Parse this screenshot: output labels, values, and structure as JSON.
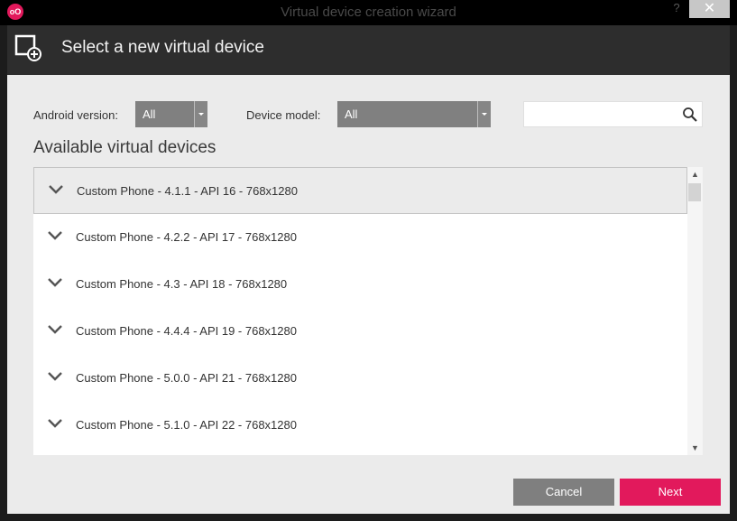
{
  "window": {
    "app_icon_text": "oO",
    "title": "Virtual device creation wizard",
    "help_label": "?",
    "close_label": "✕"
  },
  "header": {
    "title": "Select a new virtual device",
    "icon": "add-device-icon"
  },
  "filters": {
    "android_version_label": "Android version:",
    "android_version_value": "All",
    "device_model_label": "Device model:",
    "device_model_value": "All",
    "search_value": "",
    "search_icon": "search-icon"
  },
  "devices": {
    "title": "Available virtual devices",
    "items": [
      {
        "label": "Custom Phone - 4.1.1 - API 16 - 768x1280"
      },
      {
        "label": "Custom Phone - 4.2.2 - API 17 - 768x1280"
      },
      {
        "label": "Custom Phone - 4.3 - API 18 - 768x1280"
      },
      {
        "label": "Custom Phone - 4.4.4 - API 19 - 768x1280"
      },
      {
        "label": "Custom Phone - 5.0.0 - API 21 - 768x1280"
      },
      {
        "label": "Custom Phone - 5.1.0 - API 22 - 768x1280"
      }
    ],
    "selected_index": 0
  },
  "footer": {
    "cancel_label": "Cancel",
    "next_label": "Next"
  },
  "colors": {
    "accent": "#e2195c",
    "header_bg": "#2d2d2d",
    "content_bg": "#ebebeb"
  }
}
